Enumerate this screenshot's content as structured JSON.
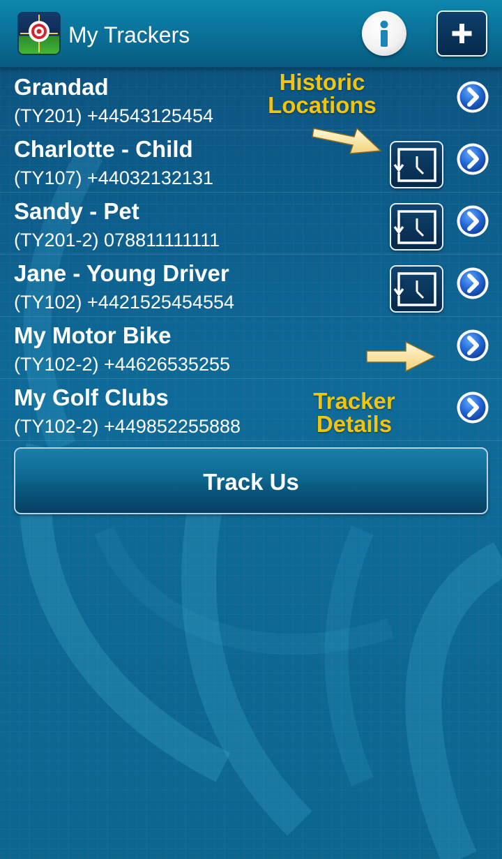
{
  "header": {
    "title": "My Trackers",
    "app_icon": "target-app-icon",
    "info_icon": "info-icon",
    "add_icon": "plus-icon"
  },
  "trackers": [
    {
      "name": "Grandad",
      "detail": "(TY201) +44543125454",
      "has_history": false
    },
    {
      "name": "Charlotte - Child",
      "detail": "(TY107) +44032132131",
      "has_history": true
    },
    {
      "name": "Sandy - Pet",
      "detail": "(TY201-2) 078811111111",
      "has_history": true
    },
    {
      "name": "Jane - Young Driver",
      "detail": "(TY102) +4421525454554",
      "has_history": true
    },
    {
      "name": "My Motor Bike",
      "detail": "(TY102-2) +44626535255",
      "has_history": false
    },
    {
      "name": "My Golf Clubs",
      "detail": "(TY102-2) +449852255888",
      "has_history": false
    }
  ],
  "annotations": {
    "historic_line1": "Historic",
    "historic_line2": "Locations",
    "details_line1": "Tracker",
    "details_line2": "Details"
  },
  "track_button": {
    "label": "Track Us"
  },
  "colors": {
    "accent": "#f1c40f",
    "background": "#0a5c8a",
    "chevron": "#2b6fd8"
  }
}
